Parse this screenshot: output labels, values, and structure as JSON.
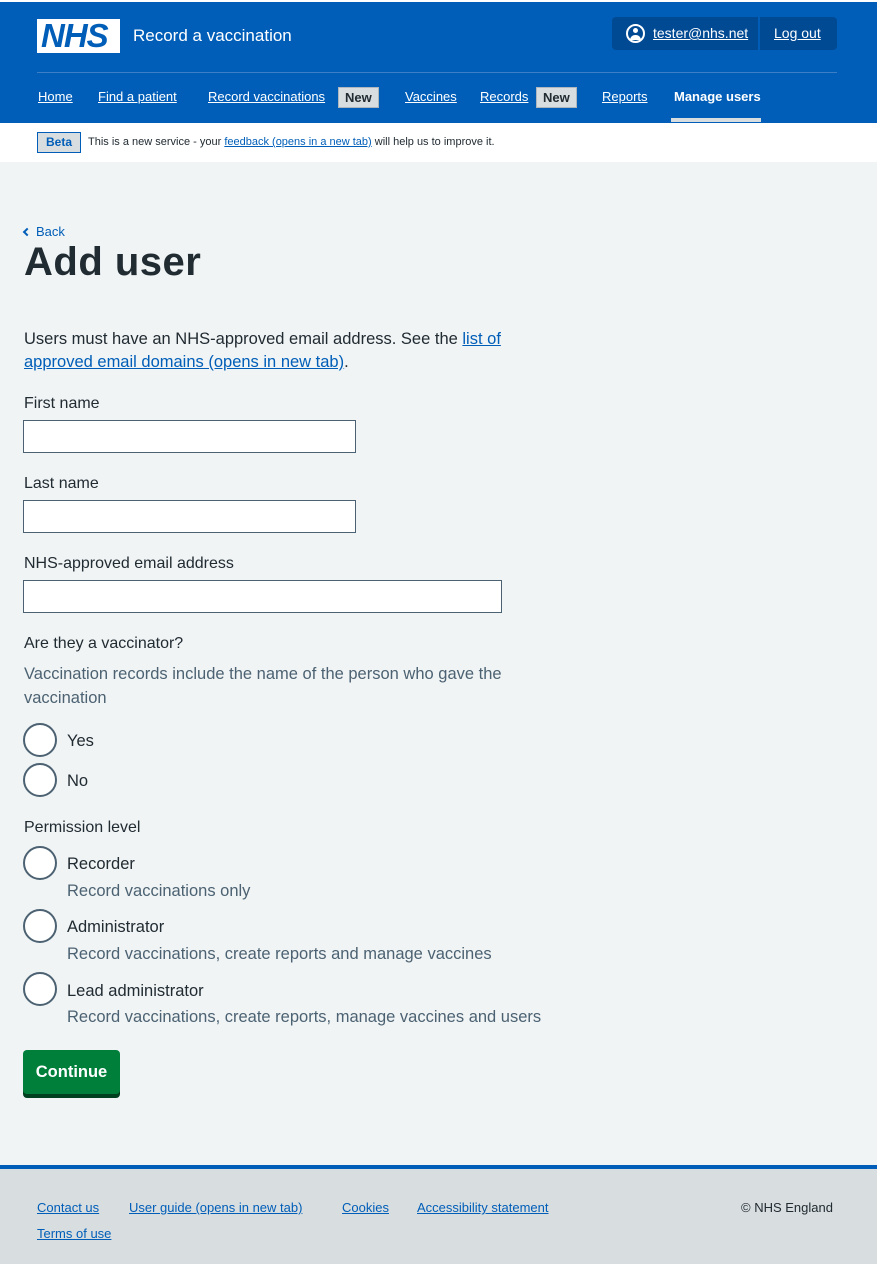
{
  "header": {
    "logo": "NHS",
    "service_name": "Record a vaccination",
    "account_email": "tester@nhs.net",
    "logout_label": "Log out",
    "brand_color": "#005eb8"
  },
  "nav": {
    "home": "Home",
    "find_patient": "Find a patient",
    "record_vaccinations": "Record vaccinations",
    "record_vaccinations_tag": "New",
    "vaccines": "Vaccines",
    "records": "Records",
    "records_tag": "New",
    "reports": "Reports",
    "manage_users": "Manage users",
    "current": "Manage users"
  },
  "beta": {
    "tag": "Beta",
    "text_before": "This is a new service - your ",
    "link": "feedback (opens in a new tab)",
    "text_after": " will help us to improve it."
  },
  "main": {
    "back_label": "Back",
    "title": "Add user",
    "intro_text": "Users must have an NHS-approved email address. See the ",
    "intro_link": "list of approved email domains (opens in new tab)",
    "intro_end": ".",
    "first_name_label": "First name",
    "first_name_value": "",
    "last_name_label": "Last name",
    "last_name_value": "",
    "email_label": "NHS-approved email address",
    "email_value": "",
    "vaccinator_label": "Are they a vaccinator?",
    "vaccinator_hint": "Vaccination records include the name of the person who gave the vaccination",
    "vaccinator_options": [
      "Yes",
      "No"
    ],
    "permission_label": "Permission level",
    "permission_options": [
      {
        "label": "Recorder",
        "hint": "Record vaccinations only"
      },
      {
        "label": "Administrator",
        "hint": "Record vaccinations, create reports and manage vaccines"
      },
      {
        "label": "Lead administrator",
        "hint": "Record vaccinations, create reports, manage vaccines and users"
      }
    ],
    "continue_label": "Continue"
  },
  "footer": {
    "links": [
      "Contact us",
      "User guide (opens in new tab)",
      "Cookies",
      "Accessibility statement",
      "Terms of use"
    ],
    "copyright": "© NHS England"
  }
}
